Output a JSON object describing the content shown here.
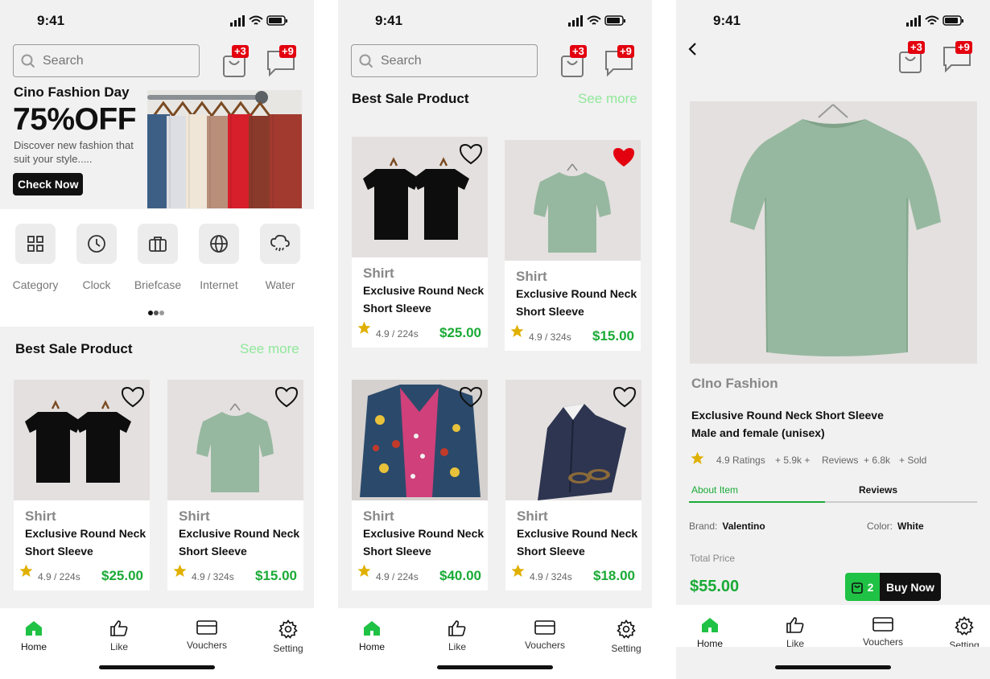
{
  "status": {
    "time": "9:41"
  },
  "search": {
    "placeholder": "Search"
  },
  "badges": {
    "cart": "+3",
    "messages": "+9"
  },
  "banner": {
    "title": "Cino Fashion Day",
    "headline": "75%OFF",
    "subtitle": "Discover new fashion that suit your style.....",
    "cta": "Check Now"
  },
  "categories": [
    {
      "label": "Category",
      "icon": "grid-icon"
    },
    {
      "label": "Clock",
      "icon": "clock-icon"
    },
    {
      "label": "Briefcase",
      "icon": "briefcase-icon"
    },
    {
      "label": "Internet",
      "icon": "globe-icon"
    },
    {
      "label": "Water",
      "icon": "cloud-rain-icon"
    }
  ],
  "section": {
    "title": "Best Sale Product",
    "see_more": "See more"
  },
  "products": [
    {
      "category": "Shirt",
      "name": "Exclusive Round Neck Short Sleeve",
      "rating": "4.9 / 224s",
      "price": "$25.00",
      "liked": false,
      "image": "two-black-tshirts"
    },
    {
      "category": "Shirt",
      "name": "Exclusive Round Neck Short Sleeve",
      "rating": "4.9 / 324s",
      "price": "$15.00",
      "liked": false,
      "image": "green-tshirt"
    },
    {
      "category": "Shirt",
      "name": "Exclusive Round Neck Short Sleeve",
      "rating": "4.9 / 224s",
      "price": "$25.00",
      "liked": false,
      "image": "two-black-tshirts"
    },
    {
      "category": "Shirt",
      "name": "Exclusive Round Neck Short Sleeve",
      "rating": "4.9 / 324s",
      "price": "$15.00",
      "liked": true,
      "image": "green-tshirt"
    },
    {
      "category": "Shirt",
      "name": "Exclusive Round Neck Short Sleeve",
      "rating": "4.9 / 224s",
      "price": "$40.00",
      "liked": false,
      "image": "patched-denim-jacket"
    },
    {
      "category": "Shirt",
      "name": "Exclusive Round Neck Short Sleeve",
      "rating": "4.9 / 324s",
      "price": "$18.00",
      "liked": false,
      "image": "navy-dress-shirt"
    }
  ],
  "tabs": [
    {
      "label": "Home",
      "icon": "home-icon",
      "active": true
    },
    {
      "label": "Like",
      "icon": "thumbs-up-icon",
      "active": false
    },
    {
      "label": "Vouchers",
      "icon": "card-icon",
      "active": false
    },
    {
      "label": "Setting",
      "icon": "gear-icon",
      "active": false
    }
  ],
  "detail": {
    "brand": "CIno Fashion",
    "name_line1": "Exclusive Round Neck Short Sleeve",
    "name_line2": "Male and female (unisex)",
    "ratings": "4.9 Ratings",
    "reviews_count": "+ 5.9k +",
    "reviews_label": "Reviews",
    "sold_count": "+ 6.8k",
    "sold_label": "+ Sold",
    "tab_about": "About Item",
    "tab_reviews": "Reviews",
    "brand_label": "Brand:",
    "brand_value": "Valentino",
    "color_label": "Color:",
    "color_value": "White",
    "total_label": "Total Price",
    "total_value": "$55.00",
    "cart_qty": "2",
    "buy_label": "Buy Now"
  },
  "colors": {
    "accent": "#1aaa36",
    "see_more": "#8fe89a",
    "badge": "#e3000f",
    "star": "#e0b000",
    "liked": "#e3000f"
  }
}
